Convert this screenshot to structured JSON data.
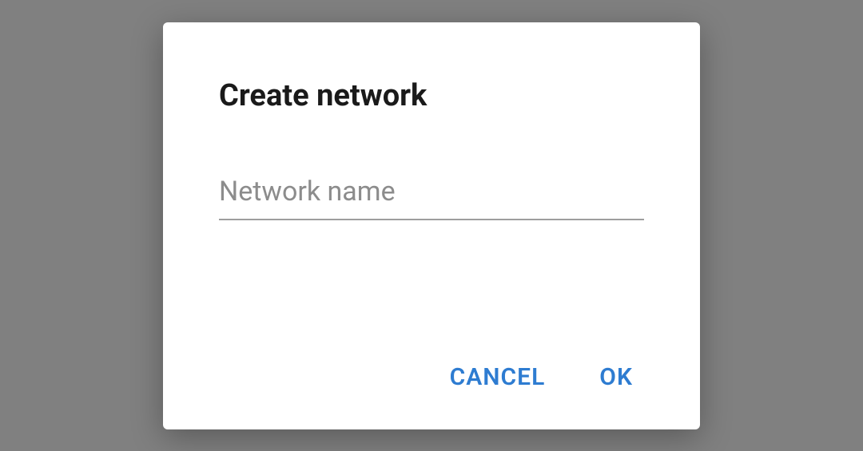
{
  "dialog": {
    "title": "Create network",
    "input": {
      "placeholder": "Network name",
      "value": ""
    },
    "actions": {
      "cancel": "CANCEL",
      "ok": "OK"
    }
  },
  "colors": {
    "accent": "#2e7cd1",
    "background": "#808080",
    "dialog_bg": "#ffffff"
  }
}
